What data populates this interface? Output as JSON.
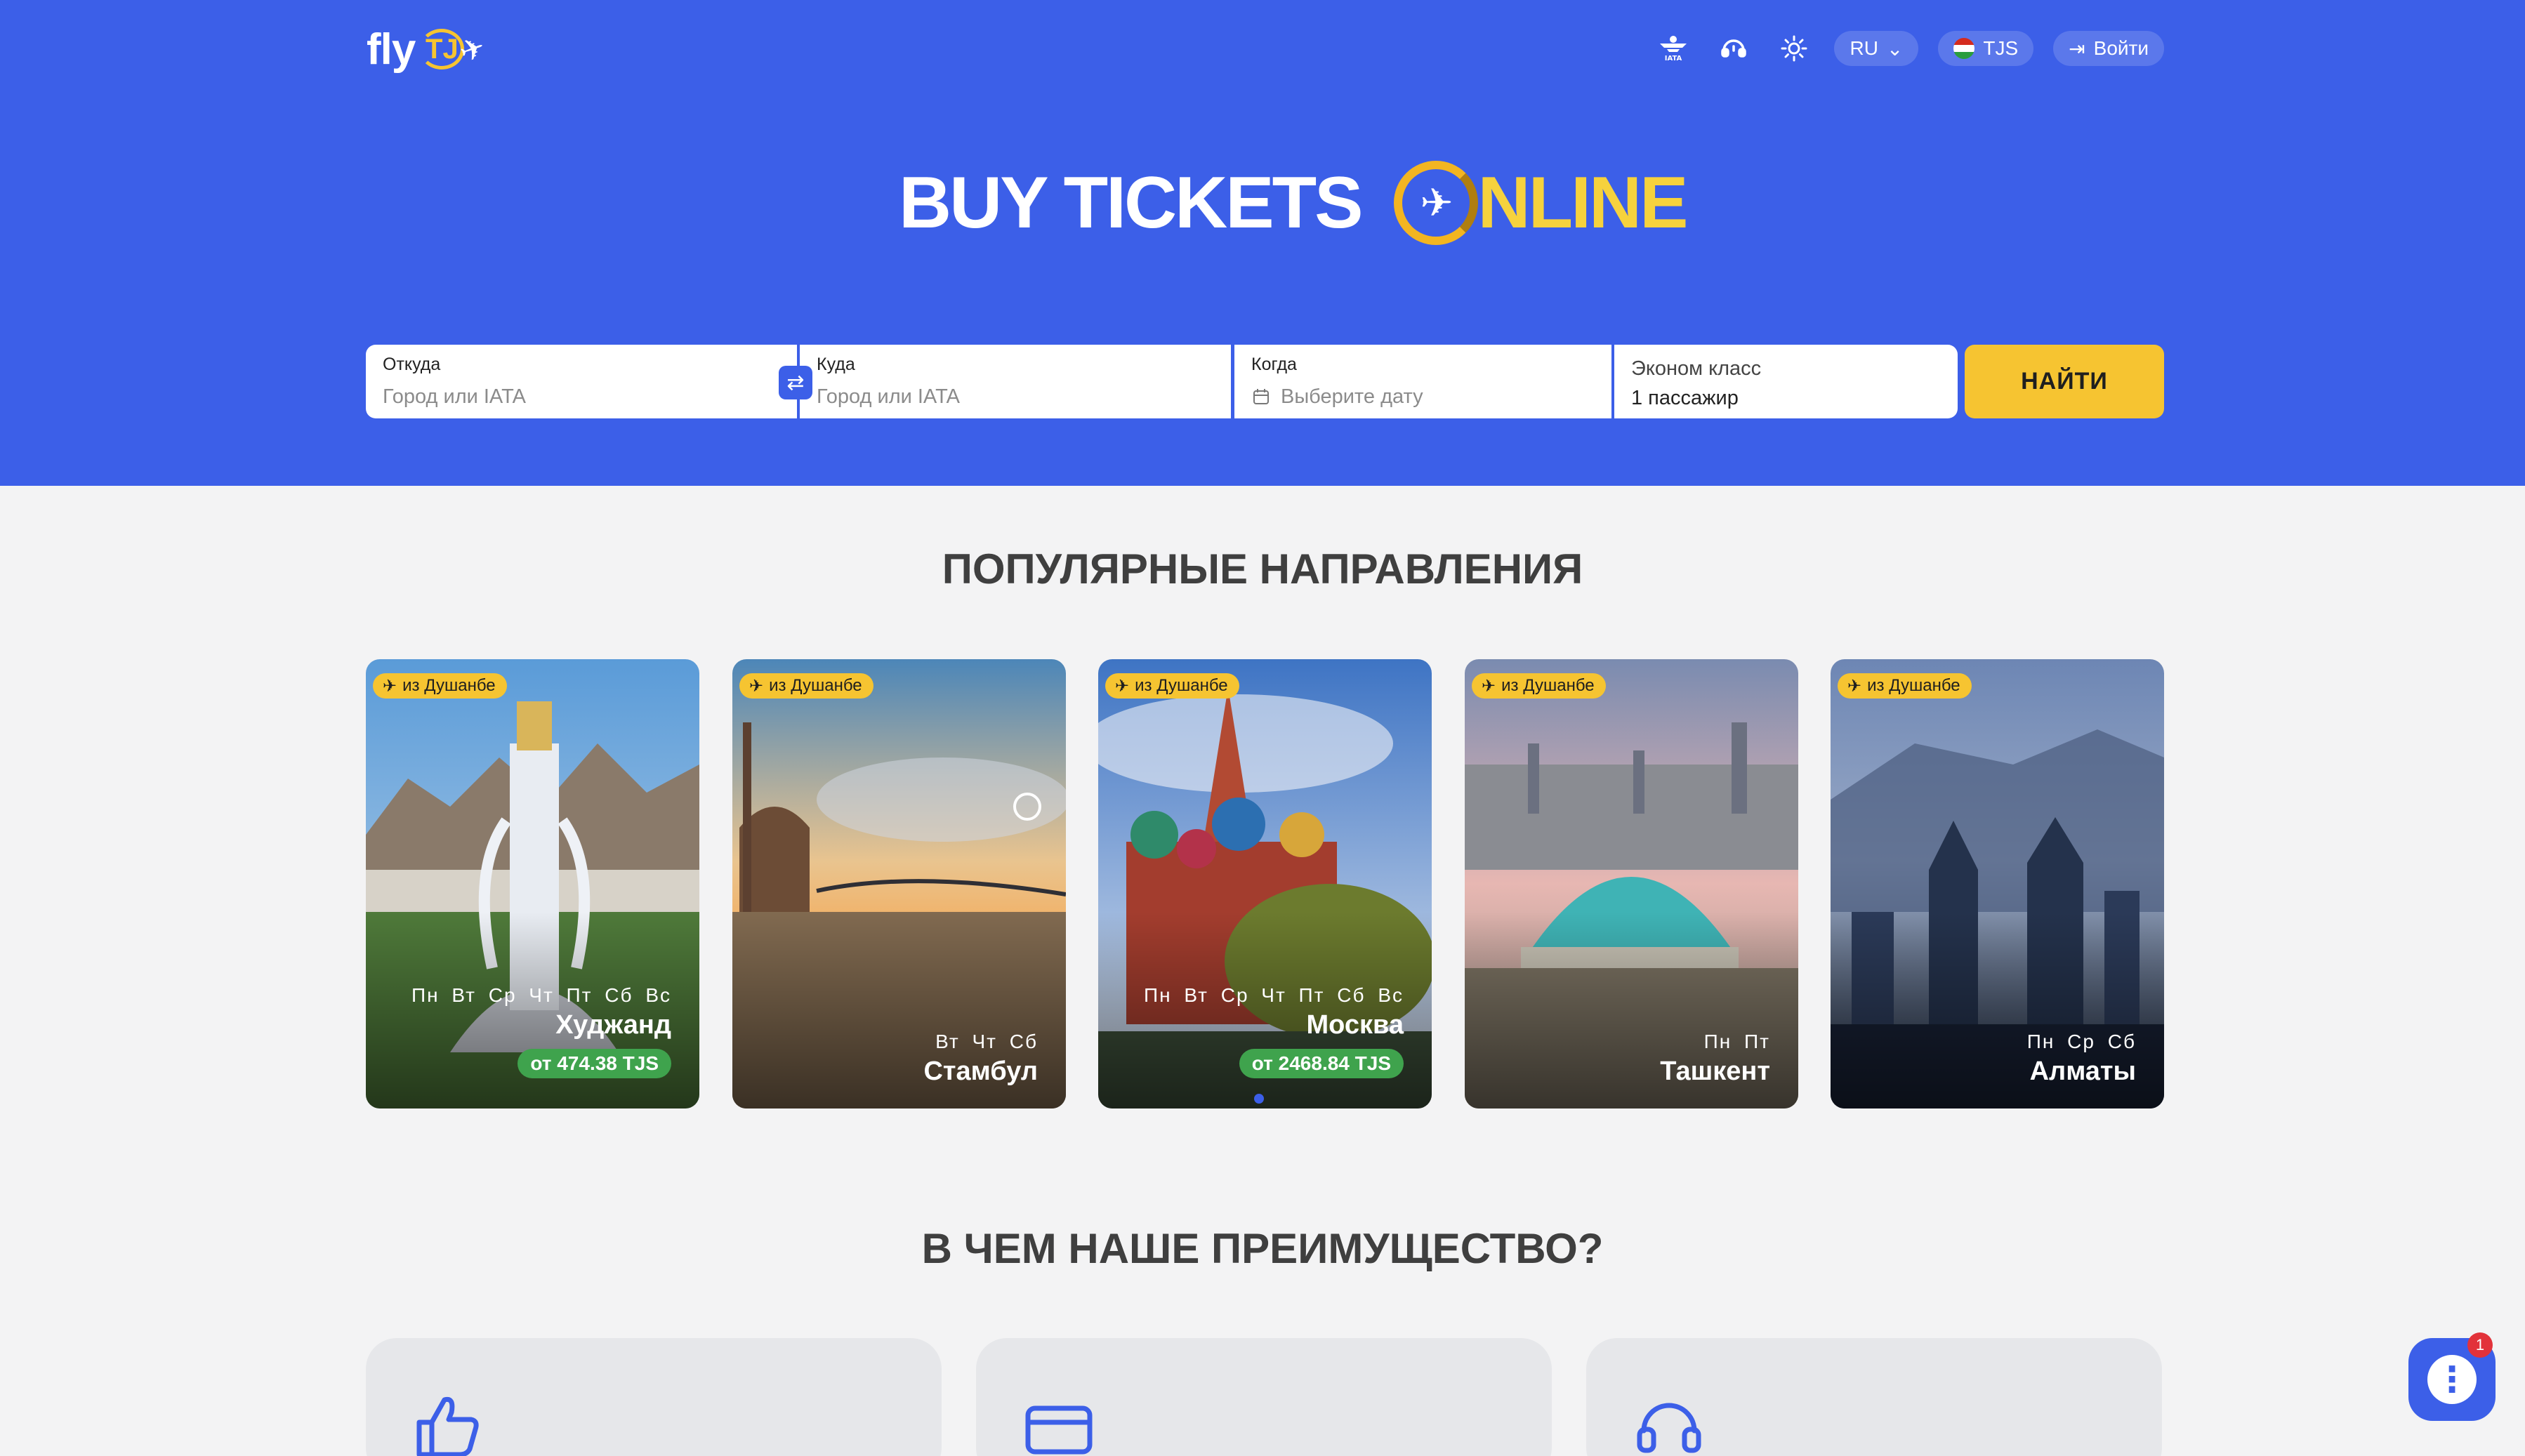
{
  "header": {
    "logo_fly": "fly",
    "logo_tj": "TJ",
    "nav": {
      "iata_icon": "iata-icon",
      "support_icon": "headset-icon",
      "theme_icon": "sun-icon",
      "language": "RU",
      "currency": "TJS",
      "login": "Войти"
    }
  },
  "hero": {
    "title_part1": "BUY TICKETS",
    "title_part2": "NLINE"
  },
  "search": {
    "from_label": "Откуда",
    "from_placeholder": "Город или IATA",
    "to_label": "Куда",
    "to_placeholder": "Город или IATA",
    "when_label": "Когда",
    "when_placeholder": "Выберите дату",
    "class": "Эконом класс",
    "passengers": "1 пассажир",
    "submit": "НАЙТИ"
  },
  "popular": {
    "title": "ПОПУЛЯРНЫЕ НАПРАВЛЕНИЯ",
    "cards": [
      {
        "tag": "из Душанбе",
        "days": "Пн Вт Ср Чт Пт Сб Вс",
        "city": "Худжанд",
        "price": "от 474.38 TJS"
      },
      {
        "tag": "из Душанбе",
        "days": "Вт Чт Сб",
        "city": "Стамбул",
        "price": ""
      },
      {
        "tag": "из Душанбе",
        "days": "Пн Вт Ср Чт Пт Сб Вс",
        "city": "Москва",
        "price": "от 2468.84 TJS"
      },
      {
        "tag": "из Душанбе",
        "days": "Пн Пт",
        "city": "Ташкент",
        "price": ""
      },
      {
        "tag": "из Душанбе",
        "days": "Пн Ср Сб",
        "city": "Алматы",
        "price": ""
      }
    ]
  },
  "advantages": {
    "title": "В ЧЕМ НАШЕ ПРЕИМУЩЕСТВО?",
    "items": [
      {
        "icon": "thumbs-up-icon"
      },
      {
        "icon": "credit-card-icon"
      },
      {
        "icon": "headset-icon"
      }
    ]
  },
  "chat": {
    "badge": "1"
  },
  "colors": {
    "brand": "#3c5fe8",
    "accent": "#f6c431",
    "price": "#3fa34d"
  }
}
